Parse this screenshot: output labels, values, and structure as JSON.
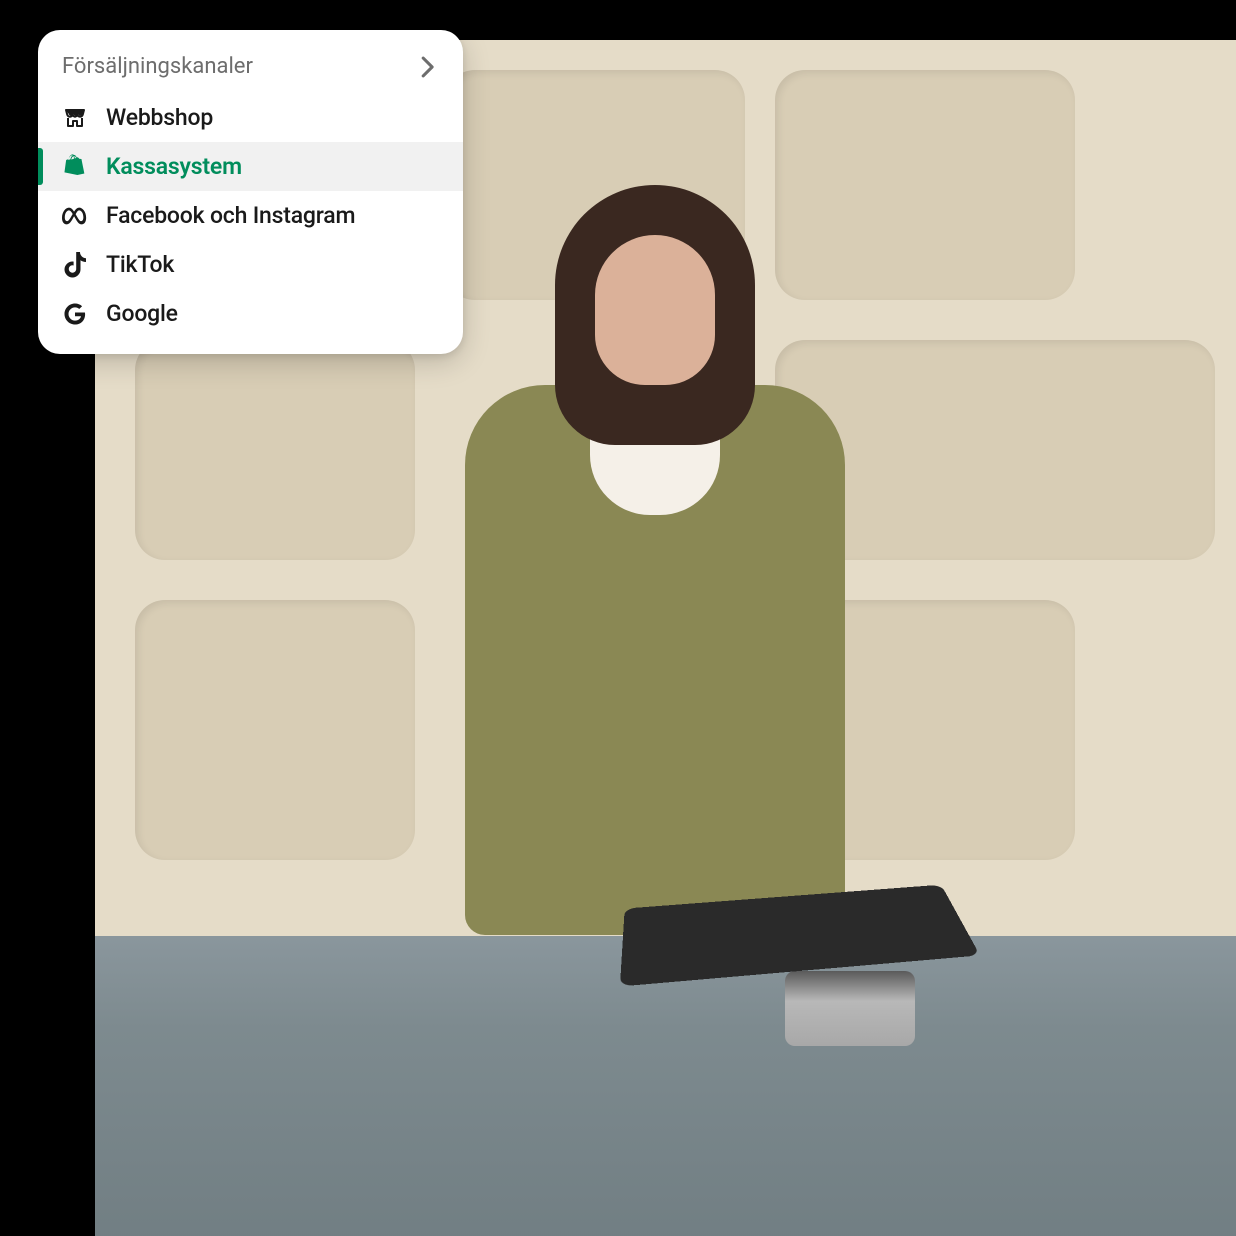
{
  "panel": {
    "title": "Försäljningskanaler",
    "items": [
      {
        "icon": "store-icon",
        "label": "Webbshop",
        "active": false
      },
      {
        "icon": "shopify-icon",
        "label": "Kassasystem",
        "active": true
      },
      {
        "icon": "meta-icon",
        "label": "Facebook och Instagram",
        "active": false
      },
      {
        "icon": "tiktok-icon",
        "label": "TikTok",
        "active": false
      },
      {
        "icon": "google-icon",
        "label": "Google",
        "active": false
      }
    ]
  },
  "colors": {
    "accent": "#018d5c",
    "muted": "#6d6d6d",
    "text": "#1a1a1a"
  }
}
